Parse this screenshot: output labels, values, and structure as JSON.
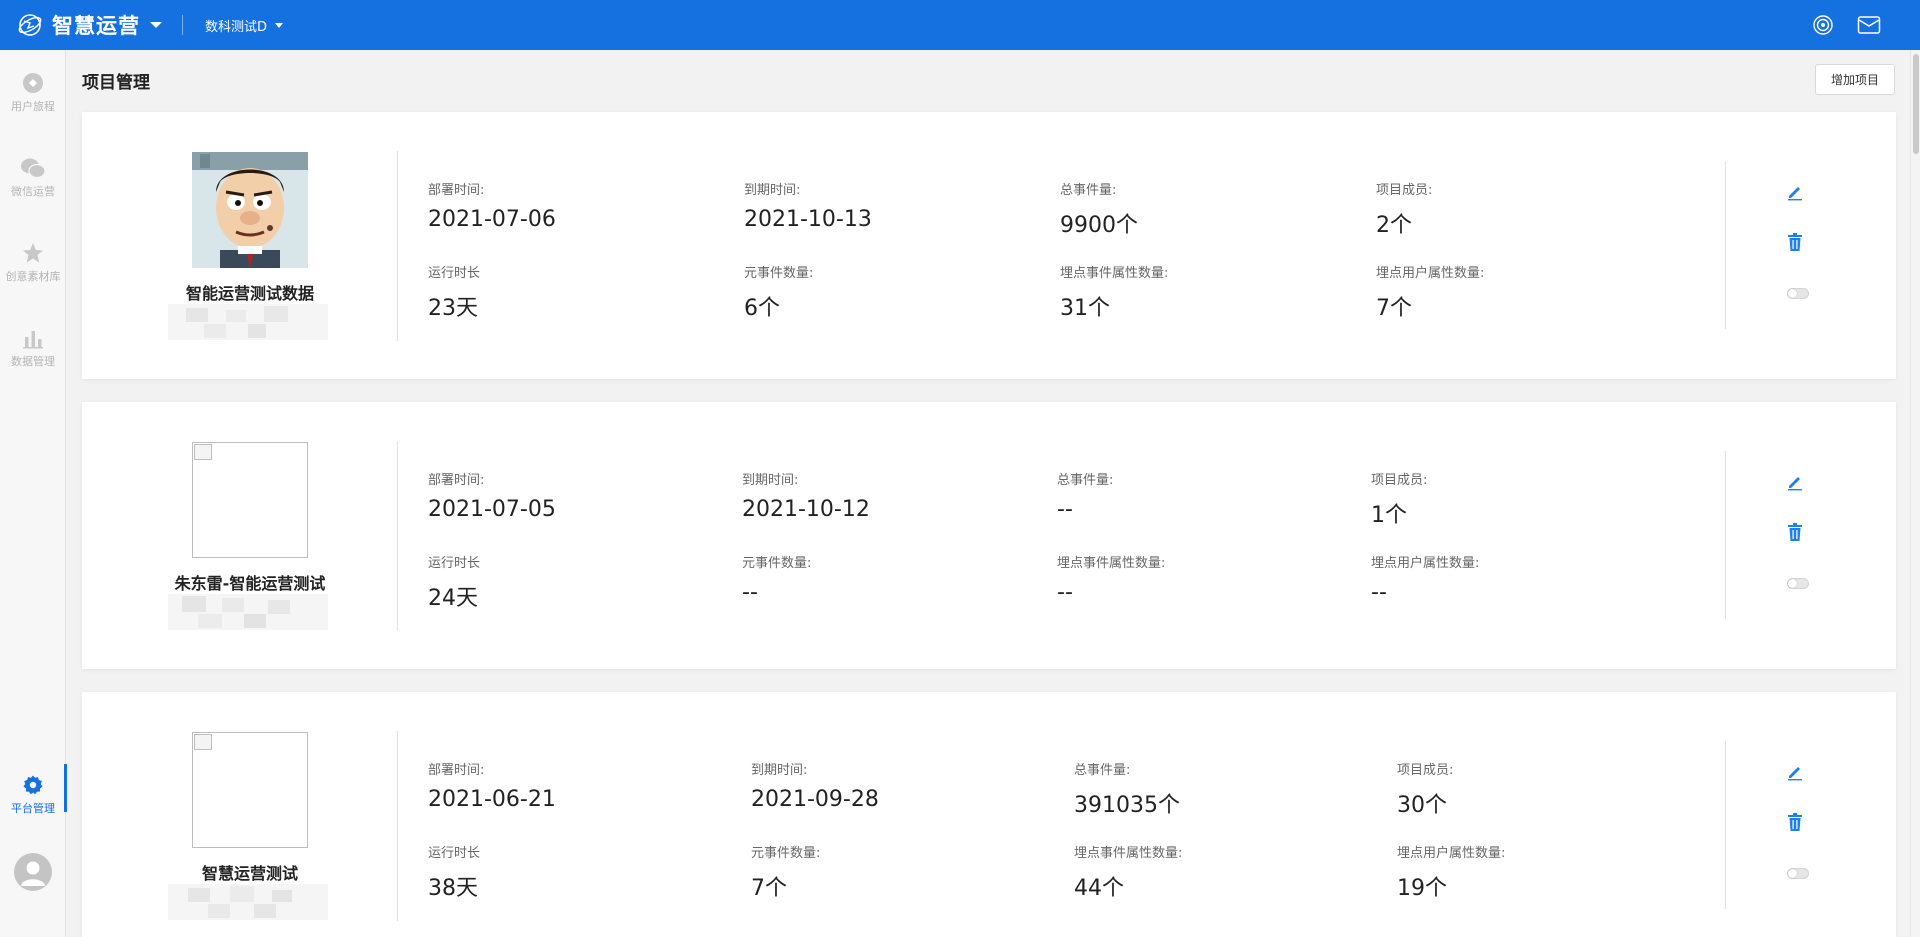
{
  "header": {
    "brand_name": "智慧运营",
    "project_name": "数科测试D"
  },
  "sidebar": {
    "items": [
      {
        "label": "用户旅程"
      },
      {
        "label": "微信运营"
      },
      {
        "label": "创意素材库"
      },
      {
        "label": "数据管理"
      },
      {
        "label": "平台管理"
      }
    ]
  },
  "page": {
    "title": "项目管理",
    "add_button": "增加项目"
  },
  "labels": {
    "deploy": "部署时间:",
    "expire": "到期时间:",
    "events_total": "总事件量:",
    "members": "项目成员:",
    "runtime": "运行时长",
    "meta_events": "元事件数量:",
    "event_props": "埋点事件属性数量:",
    "user_props": "埋点用户属性数量:"
  },
  "projects": [
    {
      "name": "智能运营测试数据",
      "deploy": "2021-07-06",
      "expire": "2021-10-13",
      "events_total": "9900个",
      "members": "2个",
      "runtime": "23天",
      "meta_events": "6个",
      "event_props": "31个",
      "user_props": "7个"
    },
    {
      "name": "朱东雷-智能运营测试",
      "deploy": "2021-07-05",
      "expire": "2021-10-12",
      "events_total": "--",
      "members": "1个",
      "runtime": "24天",
      "meta_events": "--",
      "event_props": "--",
      "user_props": "--"
    },
    {
      "name": "智慧运营测试",
      "deploy": "2021-06-21",
      "expire": "2021-09-28",
      "events_total": "391035个",
      "members": "30个",
      "runtime": "38天",
      "meta_events": "7个",
      "event_props": "44个",
      "user_props": "19个"
    }
  ],
  "colors": {
    "brand": "#1570e0",
    "action_icon": "#1e80e8"
  }
}
